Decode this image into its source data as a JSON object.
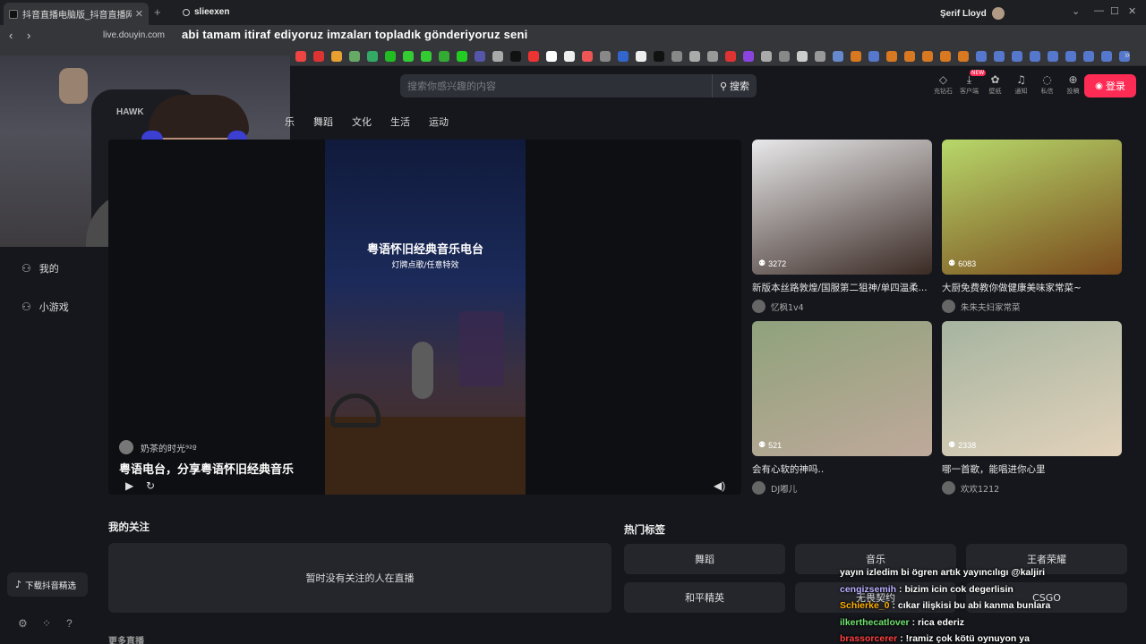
{
  "browser": {
    "tab_title": "抖音直播电脑版_抖音直播网页版",
    "new_tab": "+",
    "profile_tab": "slieexen",
    "window_user": "Şerif Lloyd",
    "url": "live.douyin.com",
    "overlay_text": "abi tamam itiraf ediyoruz imzaları topladık gönderiyoruz seni",
    "bookmark_colors": [
      "#e44",
      "#d33",
      "#e8a030",
      "#6a6",
      "#3a6",
      "#2b2",
      "#3c3",
      "#3c3",
      "#3a3",
      "#2c2",
      "#55a",
      "#aaa",
      "#111",
      "#e33",
      "#fff",
      "#eee",
      "#e55",
      "#888",
      "#3366cc",
      "#eee",
      "#111",
      "#888",
      "#aaa",
      "#999",
      "#d33",
      "#8844dd",
      "#aaa",
      "#888",
      "#ccc",
      "#999",
      "#6688cc",
      "#d87820",
      "#5577cc",
      "#d87820",
      "#d87820",
      "#d87820",
      "#d87820",
      "#d87820",
      "#5577cc",
      "#5577cc",
      "#5577cc",
      "#5577cc",
      "#5577cc",
      "#5577cc",
      "#5577cc",
      "#5577cc",
      "#5577cc"
    ]
  },
  "search": {
    "placeholder": "搜索你感兴趣的内容",
    "button": "搜索"
  },
  "top_icons": [
    {
      "label": "充钻石",
      "glyph": "◇"
    },
    {
      "label": "客户端",
      "glyph": "⤓",
      "badge": "NEW"
    },
    {
      "label": "壁纸",
      "glyph": "✿"
    },
    {
      "label": "通知",
      "glyph": "♫"
    },
    {
      "label": "私信",
      "glyph": "◌"
    },
    {
      "label": "投稿",
      "glyph": "⊕"
    }
  ],
  "login_button": "登录",
  "categories": [
    "舞蹈",
    "文化",
    "生活",
    "运动"
  ],
  "category_partial": "乐",
  "sidebar": [
    {
      "label": "我的",
      "icon": "user-icon"
    },
    {
      "label": "小游戏",
      "icon": "game-icon"
    }
  ],
  "player": {
    "streamer": "奶茶的时光⁹²º",
    "title": "粤语电台，分享粤语怀旧经典音乐",
    "video_title": "粤语怀旧经典音乐电台",
    "video_sub": "灯牌点歌/任意特效"
  },
  "cards": [
    {
      "viewers": "3272",
      "title": "新版本丝路敦煌/国服第二狙神/单四温柔...",
      "author": "忆枫1v4",
      "colors": [
        "#e8e8ea",
        "#3a2a24"
      ]
    },
    {
      "viewers": "6083",
      "title": "大厨免费教你做健康美味家常菜~",
      "author": "朱朱夫妇家常菜",
      "colors": [
        "#b7d86a",
        "#7a4a1c"
      ]
    },
    {
      "viewers": "521",
      "title": "会有心软的神吗..",
      "author": "DJ嘟儿",
      "colors": [
        "#8fa27c",
        "#bfa99a"
      ]
    },
    {
      "viewers": "2338",
      "title": "哪一首歌，能唱进你心里",
      "author": "欢欢1212",
      "colors": [
        "#a6b4a0",
        "#e2d2bb"
      ]
    }
  ],
  "following": {
    "title": "我的关注",
    "empty": "暂时没有关注的人在直播"
  },
  "hot_tags": {
    "title": "热门标签",
    "tags": [
      "舞蹈",
      "音乐",
      "王者荣耀",
      "和平精英",
      "无畏契约",
      "CSGO"
    ]
  },
  "more_live": "更多直播",
  "download_app": "下载抖音精选",
  "chat": [
    {
      "user": "",
      "user_color": "#ffffff",
      "message": "yayın izledim bi ögren artık yayıncılıgı @kaljiri"
    },
    {
      "user": "cengizsemih",
      "user_color": "#b9b0ff",
      "message": ": bizim icin cok degerlisin"
    },
    {
      "user": "Schierke_0",
      "user_color": "#ffb000",
      "message": ": cıkar ilişkisi bu abi kanma bunlara"
    },
    {
      "user": "ilkerthecatlover",
      "user_color": "#6ee36e",
      "message": ": rica ederiz"
    },
    {
      "user": "brassorcerer",
      "user_color": "#ff4040",
      "message": ": !ramiz çok kötü oynuyon ya"
    }
  ]
}
